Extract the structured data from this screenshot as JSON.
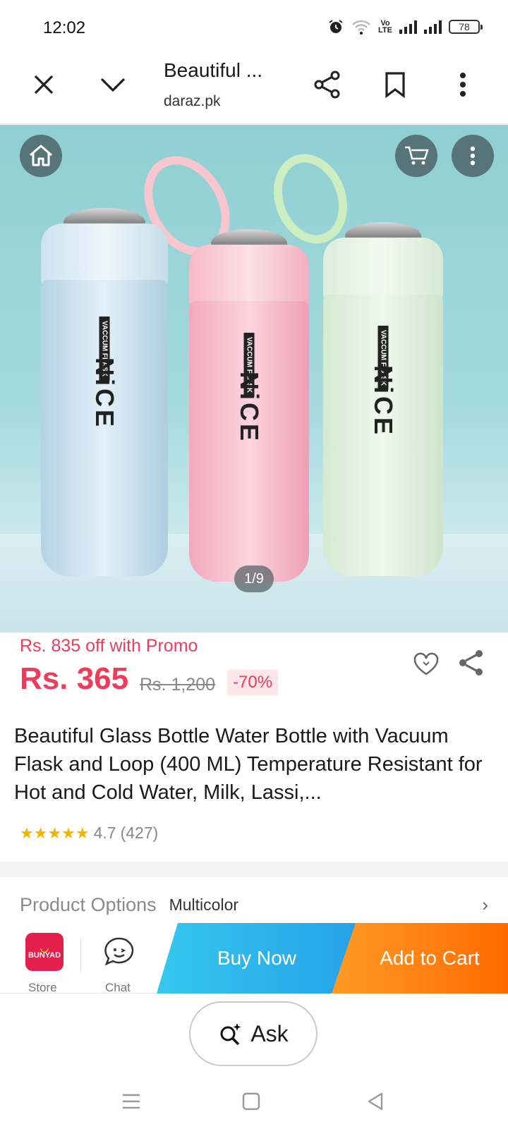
{
  "status": {
    "time": "12:02",
    "volte_top": "Vo",
    "volte_bottom": "LTE",
    "battery": "78"
  },
  "toolbar": {
    "title": "Beautiful ...",
    "url": "daraz.pk"
  },
  "gallery": {
    "counter": "1/9",
    "brand": "NiCE",
    "sub_label": "VACCUM FLASK"
  },
  "pricing": {
    "promo": "Rs. 835 off with Promo",
    "price": "Rs. 365",
    "old_price": "Rs. 1,200",
    "discount": "-70%"
  },
  "product": {
    "title": "Beautiful Glass Bottle Water Bottle with Vacuum Flask and Loop (400 ML) Temperature Resistant for Hot and Cold Water, Milk, Lassi,...",
    "stars": "★★★★★",
    "rating": "4.7",
    "reviews": "(427)"
  },
  "options": {
    "label": "Product Options",
    "value": "Multicolor",
    "chevron": "›"
  },
  "actions": {
    "store_name": "BUNYAD",
    "store_label": "Store",
    "chat_label": "Chat",
    "buy_now": "Buy Now",
    "add_to_cart": "Add to Cart"
  },
  "ask": {
    "label": "Ask"
  },
  "colors": {
    "accent": "#f03b5a",
    "buy": "#26a2e8",
    "cart": "#ff6a00",
    "star": "#f5b301"
  }
}
